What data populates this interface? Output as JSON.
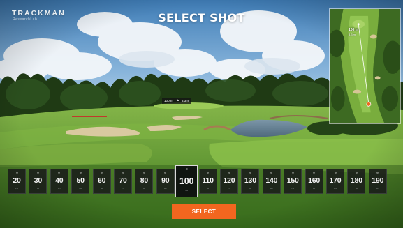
{
  "brand": {
    "name": "TRACKMAN",
    "subtitle": "ResearchLab"
  },
  "header": {
    "title": "SELECT SHOT"
  },
  "green_marker": {
    "distance": "100 m",
    "pin": "8.3 m"
  },
  "minimap": {
    "distance_label": "100 m",
    "sub_label": "8.3 m"
  },
  "distances": {
    "unit": "m",
    "selected": "100",
    "options": [
      "20",
      "30",
      "40",
      "50",
      "60",
      "70",
      "80",
      "90",
      "100",
      "110",
      "120",
      "130",
      "140",
      "150",
      "160",
      "170",
      "180",
      "190"
    ]
  },
  "actions": {
    "select_label": "SELECT"
  },
  "colors": {
    "accent": "#f2661f",
    "tile_bg": "#181a1a",
    "sky": "#5b93c6",
    "fairway": "#6fa63a"
  }
}
